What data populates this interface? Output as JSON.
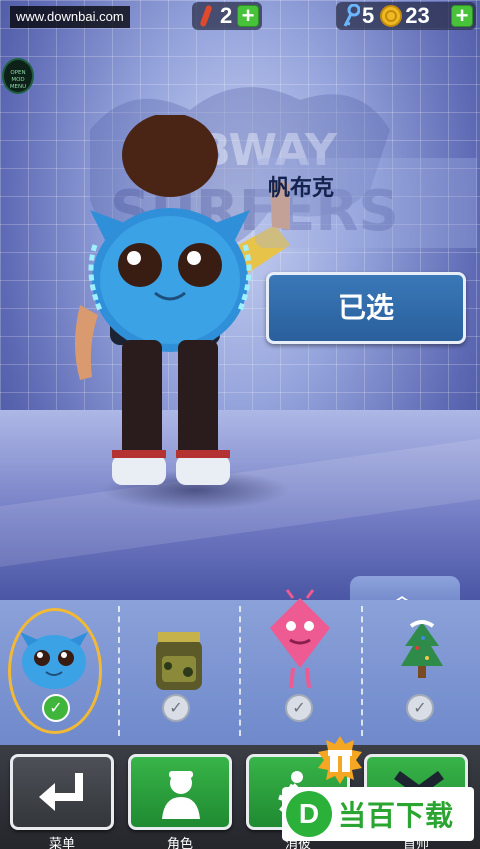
{
  "hud": {
    "watermark": "www.downbai.com",
    "boards": "2",
    "keys": "5",
    "coins": "23",
    "plus": "+",
    "mod_menu": "OPEN MOD MENU"
  },
  "character": {
    "name": "帆布克",
    "selected_label": "已选"
  },
  "strip": {
    "expand_label": "^",
    "items": [
      {
        "name": "blue-creature-backpack",
        "selected": true,
        "check": "✓"
      },
      {
        "name": "camo-backpack",
        "selected": false,
        "check": "✓"
      },
      {
        "name": "pink-kite-backpack",
        "selected": false,
        "check": "✓"
      },
      {
        "name": "christmas-tree-backpack",
        "selected": false,
        "check": "✓"
      }
    ]
  },
  "nav": {
    "menu_label": "菜单",
    "role_label": "角色",
    "shop_label": "消彼",
    "fourth_label": "首师"
  },
  "brand": {
    "logo": "D",
    "text": "当百下载"
  },
  "colors": {
    "accent_green": "#3fb53c",
    "selected_blue": "#2a5f9c",
    "ring_gold": "#f1b936"
  }
}
